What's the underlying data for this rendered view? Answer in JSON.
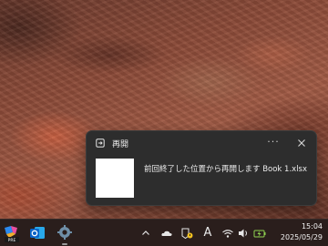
{
  "notification": {
    "app_name": "再開",
    "message": "前回終了した位置から再開します Book 1.xlsx",
    "more_label": "···"
  },
  "taskbar": {
    "copilot_badge": "PRE",
    "tray": {
      "input_mode": "A"
    },
    "clock": {
      "time": "15:04",
      "date": "2025/05/29"
    }
  }
}
